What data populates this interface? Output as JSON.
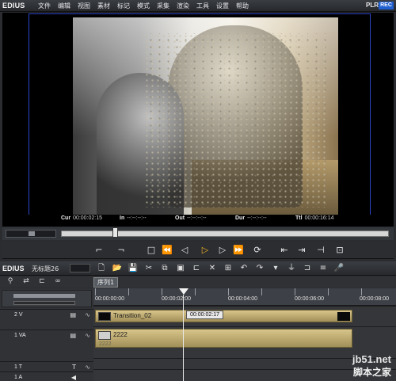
{
  "app": {
    "brand": "EDIUS"
  },
  "menu": [
    "文件",
    "编辑",
    "视图",
    "素材",
    "标记",
    "模式",
    "采集",
    "渲染",
    "工具",
    "设置",
    "帮助"
  ],
  "mode": {
    "plr": "PLR",
    "rec": "REC"
  },
  "timecodes": {
    "cur_label": "Cur",
    "cur": "00:00:02:15",
    "in_label": "In",
    "in": "--:--:--:--",
    "out_label": "Out",
    "out": "--:--:--:--",
    "dur_label": "Dur",
    "dur": "--:--:--:--",
    "ttl_label": "Ttl",
    "ttl": "00:00:16:14"
  },
  "timeline_bar": {
    "brand": "EDIUS",
    "project": "无标题26"
  },
  "sequence_tab": "序列1",
  "ruler_labels": [
    "00:00:00:00",
    "00:00:02:00",
    "00:00:04:00",
    "00:00:06:00",
    "00:00:08:00"
  ],
  "tracks": [
    {
      "name": "2 V",
      "clip": "Transition_02"
    },
    {
      "name": "1 VA",
      "clip": "2222",
      "sub": "2222"
    },
    {
      "name": "1 T"
    },
    {
      "name": "1 A"
    }
  ],
  "tooltip": "00:00:02:17",
  "watermark": {
    "line1": "jb51.net",
    "line2": "脚本之家"
  }
}
